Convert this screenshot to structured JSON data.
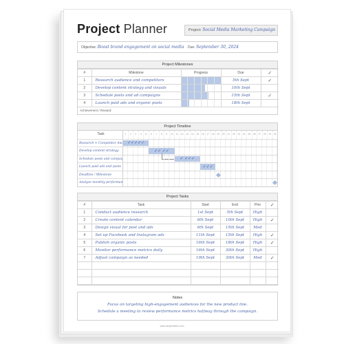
{
  "header": {
    "title_bold": "Project",
    "title_light": "Planner",
    "project_label": "Project:",
    "project_value": "Social Media Marketing Campaign",
    "objective_label": "Objective:",
    "objective_value": "Boost brand engagement on social media",
    "due_label": "Due:",
    "due_value": "September 30, 2024"
  },
  "milestones": {
    "heading": "Project Milestones",
    "columns": [
      "#",
      "Milestone",
      "Progress",
      "Due",
      "✓"
    ],
    "rows": [
      {
        "num": "1",
        "name": "Research audience and competitors",
        "progress": 1.0,
        "due": "5th Sept",
        "done": "✓"
      },
      {
        "num": "2",
        "name": "Develop content strategy and visuals",
        "progress": 0.6,
        "due": "10th Sept",
        "done": ""
      },
      {
        "num": "3",
        "name": "Schedule posts and ad campaigns",
        "progress": 0.7,
        "due": "15th Sept",
        "done": "✓"
      },
      {
        "num": "4",
        "name": "Launch paid ads and organic posts",
        "progress": 0.2,
        "due": "18th Sept",
        "done": ""
      }
    ],
    "achievement_label": "Achievement / Reward:"
  },
  "timeline": {
    "heading": "Project Timeline",
    "task_header": "Task",
    "days": [
      "1",
      "2",
      "3",
      "4",
      "5",
      "6",
      "7",
      "8",
      "9",
      "10",
      "11",
      "12",
      "13",
      "14",
      "15",
      "16",
      "17",
      "18",
      "19",
      "20",
      "21",
      "22",
      "23",
      "24",
      "25",
      "26",
      "27",
      "28",
      "29",
      "30"
    ],
    "rows": [
      {
        "label": "Research + Competitor Analysis",
        "start": 1,
        "end": 5,
        "type": "bar",
        "checks": "✓✓✓✓✓"
      },
      {
        "label": "Develop content strategy",
        "start": 6,
        "end": 10,
        "type": "bar",
        "checks": "✓✓ ✓✓"
      },
      {
        "label": "Schedule posts and campaigns",
        "start": 11,
        "end": 15,
        "type": "bar",
        "checks": "✓ ✓✓✓"
      },
      {
        "label": "Launch paid ads and posts",
        "start": 16,
        "end": 18,
        "type": "bar",
        "checks": "✓✓✓"
      },
      {
        "label": "Deadline / Milestone",
        "start": 19,
        "end": 19,
        "type": "milestone",
        "checks": ""
      },
      {
        "label": "Analyze monthly performance",
        "start": 30,
        "end": 30,
        "type": "milestone",
        "checks": ""
      }
    ]
  },
  "tasks": {
    "heading": "Project Tasks",
    "columns": [
      "#",
      "Task",
      "Start",
      "End",
      "Prio",
      "✓"
    ],
    "rows": [
      {
        "num": "1",
        "task": "Conduct audience research",
        "start": "1st Sept",
        "end": "5th Sept",
        "prio": "High",
        "done": ""
      },
      {
        "num": "2",
        "task": "Create content calendar",
        "start": "6th Sept",
        "end": "10th Sept",
        "prio": "High",
        "done": "✓"
      },
      {
        "num": "3",
        "task": "Design visual for post and ads",
        "start": "6th Sept",
        "end": "15th Sept",
        "prio": "Med",
        "done": ""
      },
      {
        "num": "4",
        "task": "Set up Facebook and Instagram ads",
        "start": "11th Sept",
        "end": "15th Sept",
        "prio": "High",
        "done": "✓"
      },
      {
        "num": "5",
        "task": "Publish organic posts",
        "start": "16th Sept",
        "end": "18th Sept",
        "prio": "High",
        "done": "✓"
      },
      {
        "num": "6",
        "task": "Monitor performance metrics daily",
        "start": "16th Sept",
        "end": "30th Sept",
        "prio": "High",
        "done": ""
      },
      {
        "num": "7",
        "task": "Adjust campaign as needed",
        "start": "19th Sept",
        "end": "30th Sept",
        "prio": "Med",
        "done": "✓"
      }
    ],
    "empty_rows": 3
  },
  "notes": {
    "heading": "Notes",
    "lines": [
      "Focus on targeting high-engagement audiences for the new product line.",
      "Schedule a meeting to review performance metrics halfway through the campaign."
    ]
  },
  "footer": {
    "url": "www.simpleslides.com"
  },
  "colors": {
    "accent_fill": "#b7c9e6",
    "handwriting": "#4a64a8"
  }
}
